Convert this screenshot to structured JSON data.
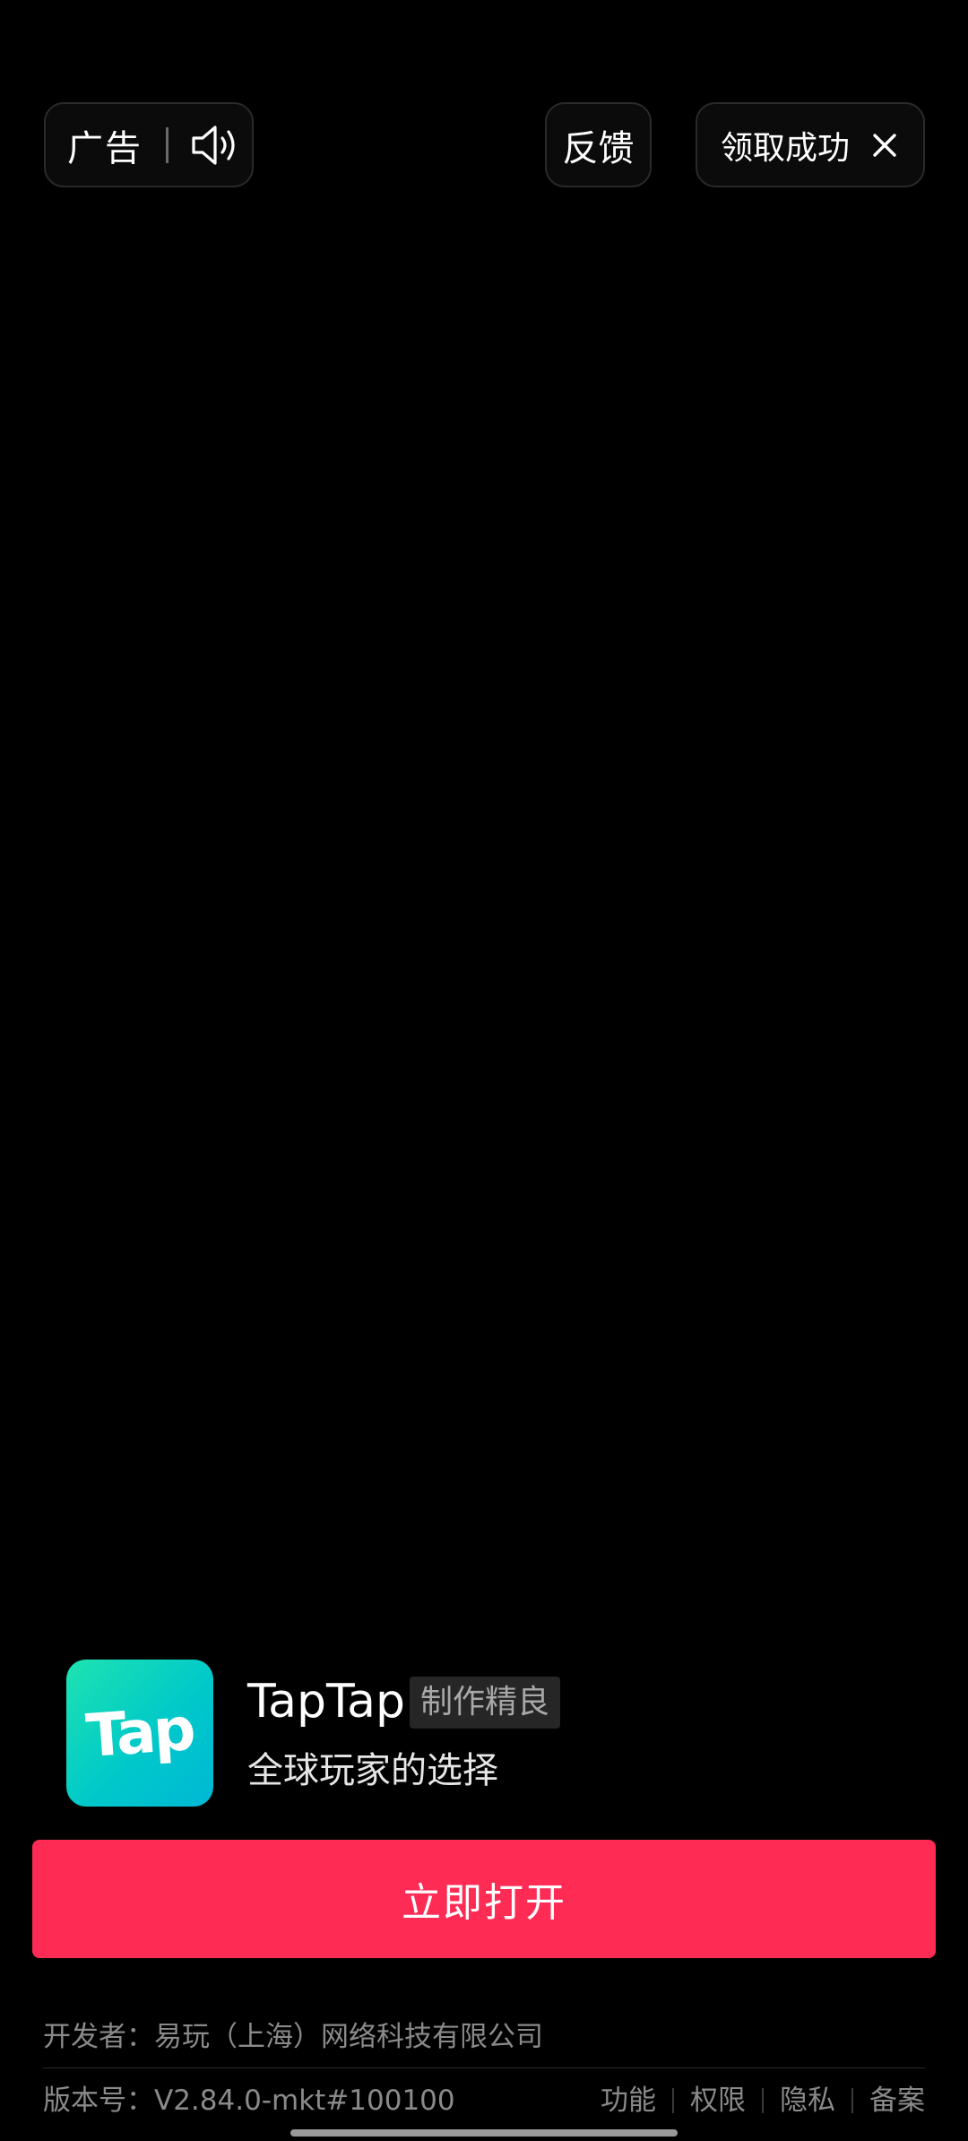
{
  "top_bar": {
    "ad_label": "广告",
    "sound_icon": "speaker-volume-icon",
    "feedback_label": "反馈",
    "claim_label": "领取成功",
    "close_icon": "close-icon"
  },
  "app": {
    "icon_text": "Tap",
    "name": "TapTap",
    "badge": "制作精良",
    "slogan": "全球玩家的选择",
    "icon_gradient": [
      "#1ee3b1",
      "#00b8d6"
    ]
  },
  "cta": {
    "label": "立即打开",
    "color": "#fe2c55"
  },
  "footer": {
    "developer": "开发者：易玩（上海）网络科技有限公司",
    "version": "版本号：V2.84.0-mkt#100100",
    "links": [
      "功能",
      "权限",
      "隐私",
      "备案"
    ]
  }
}
